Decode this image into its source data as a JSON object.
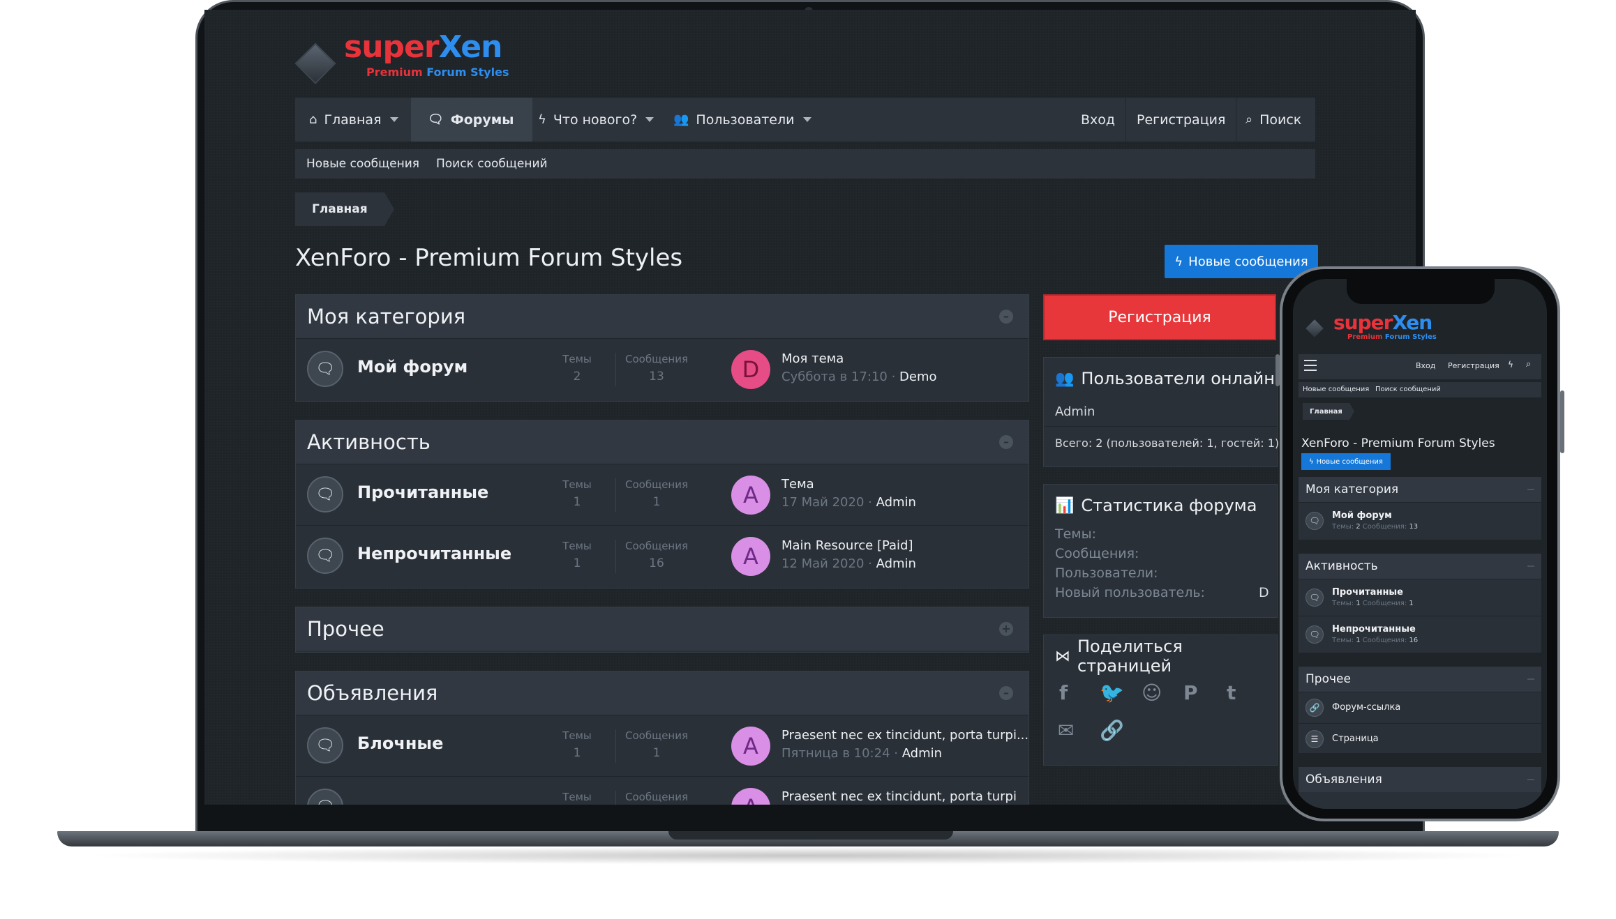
{
  "brand": {
    "word_super": "super",
    "word_xen": "Xen",
    "sub_premium": "Premium",
    "sub_rest": "Forum Styles"
  },
  "nav": {
    "items": [
      {
        "label": "Главная",
        "icon": "home-icon"
      },
      {
        "label": "Форумы",
        "icon": "chat-icon"
      },
      {
        "label": "Что нового?",
        "icon": "bolt-icon"
      },
      {
        "label": "Пользователи",
        "icon": "users-icon"
      }
    ],
    "login": "Вход",
    "register": "Регистрация",
    "search": "Поиск"
  },
  "subnav": {
    "new_posts": "Новые сообщения",
    "find_posts": "Поиск сообщений"
  },
  "breadcrumb": {
    "home": "Главная"
  },
  "page": {
    "title": "XenForo - Premium Forum Styles",
    "new_posts_button": "Новые сообщения"
  },
  "labels": {
    "threads": "Темы",
    "messages": "Сообщения"
  },
  "categories": {
    "cat1": {
      "title": "Моя категория",
      "forum": {
        "name": "Мой форум",
        "threads": "2",
        "messages": "13",
        "avatar": "D",
        "last_title": "Моя тема",
        "last_date": "Суббота в 17:10 · ",
        "last_user": "Demo"
      }
    },
    "cat2": {
      "title": "Активность",
      "forum1": {
        "name": "Прочитанные",
        "threads": "1",
        "messages": "1",
        "avatar": "A",
        "last_title": "Тема",
        "last_date": "17 Май 2020 · ",
        "last_user": "Admin"
      },
      "forum2": {
        "name": "Непрочитанные",
        "threads": "1",
        "messages": "16",
        "avatar": "A",
        "last_title": "Main Resource [Paid]",
        "last_date": "12 Май 2020 · ",
        "last_user": "Admin"
      }
    },
    "cat3": {
      "title": "Прочее"
    },
    "cat4": {
      "title": "Объявления",
      "forum1": {
        "name": "Блочные",
        "threads": "1",
        "messages": "1",
        "avatar": "A",
        "last_title": "Praesent nec ex tincidunt, porta turpi...",
        "last_date": "Пятница в 10:24 · ",
        "last_user": "Admin"
      },
      "forum2": {
        "threads_label": "Темы",
        "messages_label": "Сообщения",
        "avatar": "A",
        "last_title": "Praesent nec ex tincidunt, porta turpi"
      }
    }
  },
  "sidebar": {
    "register_button": "Регистрация",
    "online": {
      "title": "Пользователи онлайн",
      "user": "Admin",
      "total": "Всего: 2 (пользователей: 1, гостей: 1)"
    },
    "stats": {
      "title": "Статистика форума",
      "threads": "Темы:",
      "messages": "Сообщения:",
      "users": "Пользователи:",
      "newest": "Новый пользователь:",
      "newest_value": "D"
    },
    "share": {
      "title": "Поделиться страницей"
    }
  },
  "mobile": {
    "nav_login": "Вход",
    "nav_register": "Регистрация",
    "subnav_new": "Новые сообщения",
    "subnav_find": "Поиск сообщений",
    "crumb": "Главная",
    "title": "XenForo - Premium Forum Styles",
    "new_posts_button": "Новые сообщения",
    "cat1": {
      "title": "Моя категория",
      "forum": "Мой форум",
      "meta_a": "Темы: ",
      "meta_b": "2",
      "meta_c": " Сообщения: ",
      "meta_d": "13"
    },
    "cat2": {
      "title": "Активность",
      "f1": "Прочитанные",
      "f1_a": "Темы: ",
      "f1_b": "1",
      "f1_c": " Сообщения: ",
      "f1_d": "1",
      "f2": "Непрочитанные",
      "f2_a": "Темы: ",
      "f2_b": "1",
      "f2_c": " Сообщения: ",
      "f2_d": "16"
    },
    "cat3": {
      "title": "Прочее",
      "link": "Форум-ссылка",
      "page": "Страница"
    },
    "cat4": {
      "title": "Объявления"
    }
  },
  "colors": {
    "accent_red": "#e8373b",
    "accent_blue": "#1577d8",
    "avatar_d": "#e64c86",
    "avatar_a": "#d98fe6",
    "bg": "#1f2429"
  }
}
